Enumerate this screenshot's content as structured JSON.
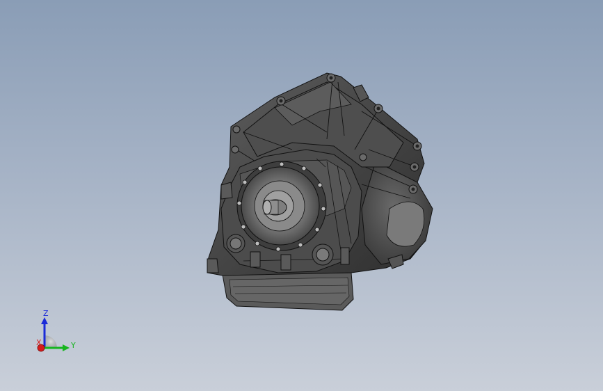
{
  "viewport": {
    "background_top": "#8a9db6",
    "background_bottom": "#c9cfd9"
  },
  "model": {
    "icon": "transmission-gearbox-3d-model",
    "body_color": "#4a4a4a",
    "edge_color": "#111111"
  },
  "triad": {
    "z_label": "Z",
    "y_label": "Y",
    "x_label": "X",
    "z_color": "#1a2ad8",
    "y_color": "#17b51f",
    "x_color": "#d61a1a"
  }
}
